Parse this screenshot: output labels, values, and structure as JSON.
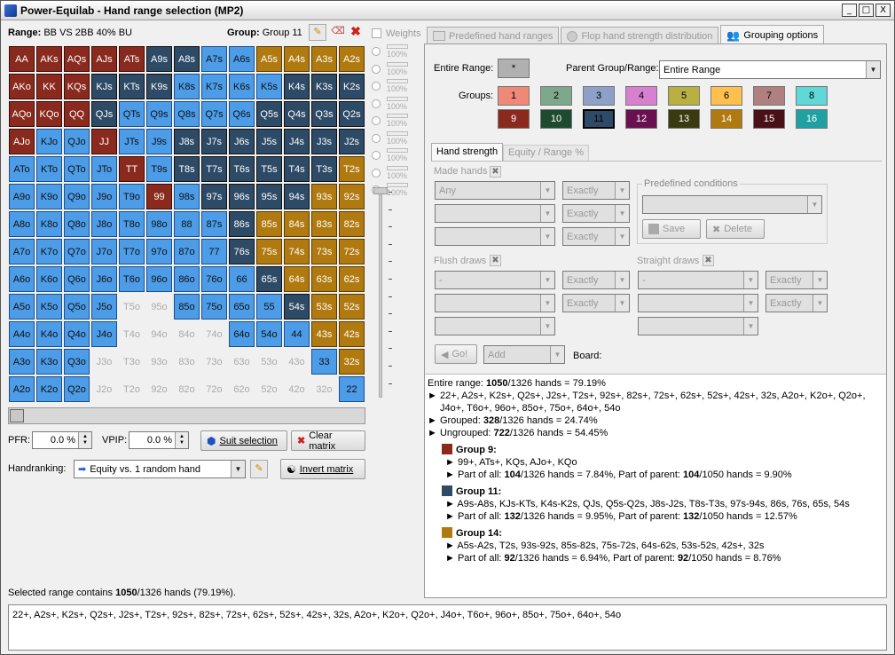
{
  "window": {
    "title": "Power-Equilab - Hand range selection (MP2)",
    "buttons": [
      "_",
      "□",
      "X"
    ]
  },
  "range": {
    "label": "Range:",
    "value": "BB VS 2BB 40% BU"
  },
  "group": {
    "label": "Group:",
    "value": "Group 11"
  },
  "weights": {
    "label": "Weights",
    "rows": [
      "100%",
      "100%",
      "100%",
      "100%",
      "100%",
      "100%",
      "100%",
      "100%",
      "100%"
    ]
  },
  "matrix": {
    "rows": [
      [
        [
          "AA",
          "g9"
        ],
        [
          "AKs",
          "g9"
        ],
        [
          "AQs",
          "g9"
        ],
        [
          "AJs",
          "g9"
        ],
        [
          "ATs",
          "g9"
        ],
        [
          "A9s",
          "g11"
        ],
        [
          "A8s",
          "g11"
        ],
        [
          "A7s",
          "g1"
        ],
        [
          "A6s",
          "g1"
        ],
        [
          "A5s",
          "g14"
        ],
        [
          "A4s",
          "g14"
        ],
        [
          "A3s",
          "g14"
        ],
        [
          "A2s",
          "g14"
        ]
      ],
      [
        [
          "AKo",
          "g9"
        ],
        [
          "KK",
          "g9"
        ],
        [
          "KQs",
          "g9"
        ],
        [
          "KJs",
          "g11"
        ],
        [
          "KTs",
          "g11"
        ],
        [
          "K9s",
          "g11"
        ],
        [
          "K8s",
          "g1"
        ],
        [
          "K7s",
          "g1"
        ],
        [
          "K6s",
          "g1"
        ],
        [
          "K5s",
          "g1"
        ],
        [
          "K4s",
          "g11"
        ],
        [
          "K3s",
          "g11"
        ],
        [
          "K2s",
          "g11"
        ]
      ],
      [
        [
          "AQo",
          "g9"
        ],
        [
          "KQo",
          "g9"
        ],
        [
          "QQ",
          "g9"
        ],
        [
          "QJs",
          "g11"
        ],
        [
          "QTs",
          "g1"
        ],
        [
          "Q9s",
          "g1"
        ],
        [
          "Q8s",
          "g1"
        ],
        [
          "Q7s",
          "g1"
        ],
        [
          "Q6s",
          "g1"
        ],
        [
          "Q5s",
          "g11"
        ],
        [
          "Q4s",
          "g11"
        ],
        [
          "Q3s",
          "g11"
        ],
        [
          "Q2s",
          "g11"
        ]
      ],
      [
        [
          "AJo",
          "g9"
        ],
        [
          "KJo",
          "g1"
        ],
        [
          "QJo",
          "g1"
        ],
        [
          "JJ",
          "g9"
        ],
        [
          "JTs",
          "g1"
        ],
        [
          "J9s",
          "g1"
        ],
        [
          "J8s",
          "g11"
        ],
        [
          "J7s",
          "g11"
        ],
        [
          "J6s",
          "g11"
        ],
        [
          "J5s",
          "g11"
        ],
        [
          "J4s",
          "g11"
        ],
        [
          "J3s",
          "g11"
        ],
        [
          "J2s",
          "g11"
        ]
      ],
      [
        [
          "ATo",
          "g1"
        ],
        [
          "KTo",
          "g1"
        ],
        [
          "QTo",
          "g1"
        ],
        [
          "JTo",
          "g1"
        ],
        [
          "TT",
          "g9"
        ],
        [
          "T9s",
          "g1"
        ],
        [
          "T8s",
          "g11"
        ],
        [
          "T7s",
          "g11"
        ],
        [
          "T6s",
          "g11"
        ],
        [
          "T5s",
          "g11"
        ],
        [
          "T4s",
          "g11"
        ],
        [
          "T3s",
          "g11"
        ],
        [
          "T2s",
          "g14"
        ]
      ],
      [
        [
          "A9o",
          "g1"
        ],
        [
          "K9o",
          "g1"
        ],
        [
          "Q9o",
          "g1"
        ],
        [
          "J9o",
          "g1"
        ],
        [
          "T9o",
          "g1"
        ],
        [
          "99",
          "g9"
        ],
        [
          "98s",
          "g1"
        ],
        [
          "97s",
          "g11"
        ],
        [
          "96s",
          "g11"
        ],
        [
          "95s",
          "g11"
        ],
        [
          "94s",
          "g11"
        ],
        [
          "93s",
          "g14"
        ],
        [
          "92s",
          "g14"
        ]
      ],
      [
        [
          "A8o",
          "g1"
        ],
        [
          "K8o",
          "g1"
        ],
        [
          "Q8o",
          "g1"
        ],
        [
          "J8o",
          "g1"
        ],
        [
          "T8o",
          "g1"
        ],
        [
          "98o",
          "g1"
        ],
        [
          "88",
          "g1"
        ],
        [
          "87s",
          "g1"
        ],
        [
          "86s",
          "g11"
        ],
        [
          "85s",
          "g14"
        ],
        [
          "84s",
          "g14"
        ],
        [
          "83s",
          "g14"
        ],
        [
          "82s",
          "g14"
        ]
      ],
      [
        [
          "A7o",
          "g1"
        ],
        [
          "K7o",
          "g1"
        ],
        [
          "Q7o",
          "g1"
        ],
        [
          "J7o",
          "g1"
        ],
        [
          "T7o",
          "g1"
        ],
        [
          "97o",
          "g1"
        ],
        [
          "87o",
          "g1"
        ],
        [
          "77",
          "g1"
        ],
        [
          "76s",
          "g11"
        ],
        [
          "75s",
          "g14"
        ],
        [
          "74s",
          "g14"
        ],
        [
          "73s",
          "g14"
        ],
        [
          "72s",
          "g14"
        ]
      ],
      [
        [
          "A6o",
          "g1"
        ],
        [
          "K6o",
          "g1"
        ],
        [
          "Q6o",
          "g1"
        ],
        [
          "J6o",
          "g1"
        ],
        [
          "T6o",
          "g1"
        ],
        [
          "96o",
          "g1"
        ],
        [
          "86o",
          "g1"
        ],
        [
          "76o",
          "g1"
        ],
        [
          "66",
          "g1"
        ],
        [
          "65s",
          "g11"
        ],
        [
          "64s",
          "g14"
        ],
        [
          "63s",
          "g14"
        ],
        [
          "62s",
          "g14"
        ]
      ],
      [
        [
          "A5o",
          "g1"
        ],
        [
          "K5o",
          "g1"
        ],
        [
          "Q5o",
          "g1"
        ],
        [
          "J5o",
          "g1"
        ],
        [
          "T5o",
          "none"
        ],
        [
          "95o",
          "none"
        ],
        [
          "85o",
          "g1"
        ],
        [
          "75o",
          "g1"
        ],
        [
          "65o",
          "g1"
        ],
        [
          "55",
          "g1"
        ],
        [
          "54s",
          "g11"
        ],
        [
          "53s",
          "g14"
        ],
        [
          "52s",
          "g14"
        ]
      ],
      [
        [
          "A4o",
          "g1"
        ],
        [
          "K4o",
          "g1"
        ],
        [
          "Q4o",
          "g1"
        ],
        [
          "J4o",
          "g1"
        ],
        [
          "T4o",
          "none"
        ],
        [
          "94o",
          "none"
        ],
        [
          "84o",
          "none"
        ],
        [
          "74o",
          "none"
        ],
        [
          "64o",
          "g1"
        ],
        [
          "54o",
          "g1"
        ],
        [
          "44",
          "g1"
        ],
        [
          "43s",
          "g14"
        ],
        [
          "42s",
          "g14"
        ]
      ],
      [
        [
          "A3o",
          "g1"
        ],
        [
          "K3o",
          "g1"
        ],
        [
          "Q3o",
          "g1"
        ],
        [
          "J3o",
          "none"
        ],
        [
          "T3o",
          "none"
        ],
        [
          "93o",
          "none"
        ],
        [
          "83o",
          "none"
        ],
        [
          "73o",
          "none"
        ],
        [
          "63o",
          "none"
        ],
        [
          "53o",
          "none"
        ],
        [
          "43o",
          "none"
        ],
        [
          "33",
          "g1"
        ],
        [
          "32s",
          "g14"
        ]
      ],
      [
        [
          "A2o",
          "g1"
        ],
        [
          "K2o",
          "g1"
        ],
        [
          "Q2o",
          "g1"
        ],
        [
          "J2o",
          "none"
        ],
        [
          "T2o",
          "none"
        ],
        [
          "92o",
          "none"
        ],
        [
          "82o",
          "none"
        ],
        [
          "72o",
          "none"
        ],
        [
          "62o",
          "none"
        ],
        [
          "52o",
          "none"
        ],
        [
          "42o",
          "none"
        ],
        [
          "32o",
          "none"
        ],
        [
          "22",
          "g1"
        ]
      ]
    ]
  },
  "controls": {
    "pfr_label": "PFR:",
    "pfr_value": "0.0 %",
    "vpip_label": "VPIP:",
    "vpip_value": "0.0 %",
    "suit_selection": "Suit selection",
    "clear_matrix": "Clear matrix",
    "handranking_label": "Handranking:",
    "handranking_value": "Equity vs. 1 random hand",
    "invert_matrix": "Invert matrix"
  },
  "summary": {
    "prefix": "Selected range contains ",
    "bold": "1050",
    "suffix": "/1326 hands (79.19%)."
  },
  "range_text": "22+, A2s+, K2s+, Q2s+, J2s+, T2s+, 92s+, 82s+, 72s+, 62s+, 52s+, 42s+, 32s, A2o+, K2o+, Q2o+, J4o+, T6o+, 96o+, 85o+, 75o+, 64o+, 54o",
  "tabs": [
    "Predefined hand ranges",
    "Flop hand strength distribution",
    "Grouping options"
  ],
  "grouping": {
    "entire_range_label": "Entire Range:",
    "entire_range_btn": "*",
    "parent_label": "Parent Group/Range:",
    "parent_value": "Entire Range",
    "groups_label": "Groups:",
    "groups": [
      {
        "n": "1",
        "c": "#f08878",
        "fg": "#000"
      },
      {
        "n": "2",
        "c": "#7ea88c",
        "fg": "#000"
      },
      {
        "n": "3",
        "c": "#8ca0c8",
        "fg": "#000"
      },
      {
        "n": "4",
        "c": "#d880d0",
        "fg": "#000"
      },
      {
        "n": "5",
        "c": "#b8b040",
        "fg": "#000"
      },
      {
        "n": "6",
        "c": "#ffc050",
        "fg": "#000"
      },
      {
        "n": "7",
        "c": "#b08080",
        "fg": "#000"
      },
      {
        "n": "8",
        "c": "#60d8d8",
        "fg": "#000"
      },
      {
        "n": "9",
        "c": "#8a2a1e",
        "fg": "#fff"
      },
      {
        "n": "10",
        "c": "#1e4a30",
        "fg": "#fff"
      },
      {
        "n": "11",
        "c": "#2d4a66",
        "fg": "#000"
      },
      {
        "n": "12",
        "c": "#6a1050",
        "fg": "#fff"
      },
      {
        "n": "13",
        "c": "#3a3a10",
        "fg": "#fff"
      },
      {
        "n": "14",
        "c": "#b07a10",
        "fg": "#fff"
      },
      {
        "n": "15",
        "c": "#4a1018",
        "fg": "#fff"
      },
      {
        "n": "16",
        "c": "#20a0a0",
        "fg": "#fff"
      }
    ]
  },
  "subtabs": [
    "Hand strength",
    "Equity / Range %"
  ],
  "hand_strength": {
    "made_hands": "Made hands",
    "any": "Any",
    "exactly": "Exactly",
    "predefined_conditions": "Predefined conditions",
    "save": "Save",
    "delete": "Delete",
    "flush_draws": "Flush draws",
    "straight_draws": "Straight draws",
    "dash": "-",
    "go": "Go!",
    "add": "Add",
    "board": "Board:"
  },
  "info": {
    "entire": {
      "a": "Entire range: ",
      "b": "1050",
      "c": "/1326 hands = 79.19%"
    },
    "range1": "22+, A2s+, K2s+, Q2s+, J2s+, T2s+, 92s+, 82s+, 72s+, 62s+, 52s+, 42s+, 32s, A2o+, K2o+, Q2o+,",
    "range2": "J4o+, T6o+, 96o+, 85o+, 75o+, 64o+, 54o",
    "grouped": {
      "a": "Grouped: ",
      "b": "328",
      "c": "/1326 hands = 24.74%"
    },
    "ungrouped": {
      "a": "Ungrouped: ",
      "b": "722",
      "c": "/1326 hands = 54.45%"
    },
    "groups": [
      {
        "name": "Group 9:",
        "color": "#8a2a1e",
        "hands": "99+, ATs+, KQs, AJo+, KQo",
        "all": "104",
        "all_pct": "/1326 hands = 7.84%, Part of parent: ",
        "parent": "104",
        "parent_pct": "/1050 hands = 9.90%"
      },
      {
        "name": "Group 11:",
        "color": "#2d4a66",
        "hands": "A9s-A8s, KJs-KTs, K4s-K2s, QJs, Q5s-Q2s, J8s-J2s, T8s-T3s, 97s-94s, 86s, 76s, 65s, 54s",
        "all": "132",
        "all_pct": "/1326 hands = 9.95%, Part of parent: ",
        "parent": "132",
        "parent_pct": "/1050 hands = 12.57%"
      },
      {
        "name": "Group 14:",
        "color": "#b07a10",
        "hands": "A5s-A2s, T2s, 93s-92s, 85s-82s, 75s-72s, 64s-62s, 53s-52s, 42s+, 32s",
        "all": "92",
        "all_pct": "/1326 hands = 6.94%, Part of parent: ",
        "parent": "92",
        "parent_pct": "/1050 hands = 8.76%"
      }
    ],
    "part_of_all": "Part of all: "
  }
}
